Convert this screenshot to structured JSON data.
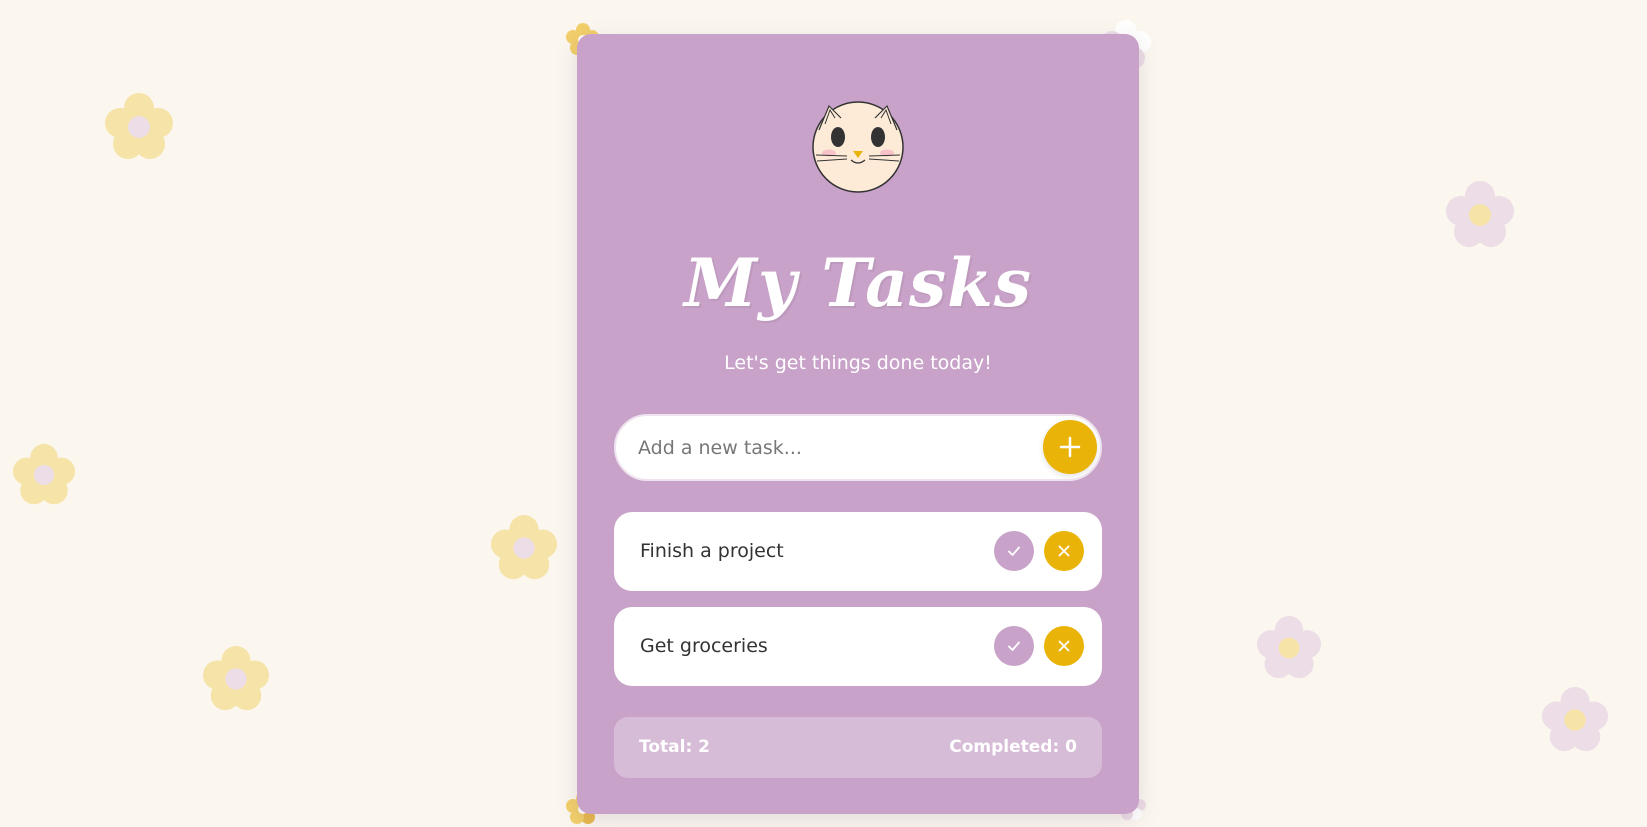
{
  "app": {
    "title": "My Tasks",
    "subtitle": "Let's get things done today!",
    "avatar_icon": "cat-face-icon"
  },
  "add_task": {
    "placeholder": "Add a new task...",
    "value": "",
    "button_icon": "plus-icon"
  },
  "tasks": [
    {
      "text": "Finish a project",
      "completed": false,
      "complete_icon": "check-icon",
      "delete_icon": "close-icon"
    },
    {
      "text": "Get groceries",
      "completed": false,
      "complete_icon": "check-icon",
      "delete_icon": "close-icon"
    }
  ],
  "stats": {
    "total_label": "Total: 2",
    "completed_label": "Completed: 0"
  },
  "colors": {
    "background": "#fbf7ef",
    "card": "#c8a2c8",
    "accent": "#eab308",
    "flower_yellow": "#f6e3a8",
    "flower_lilac": "#ecdde6"
  }
}
